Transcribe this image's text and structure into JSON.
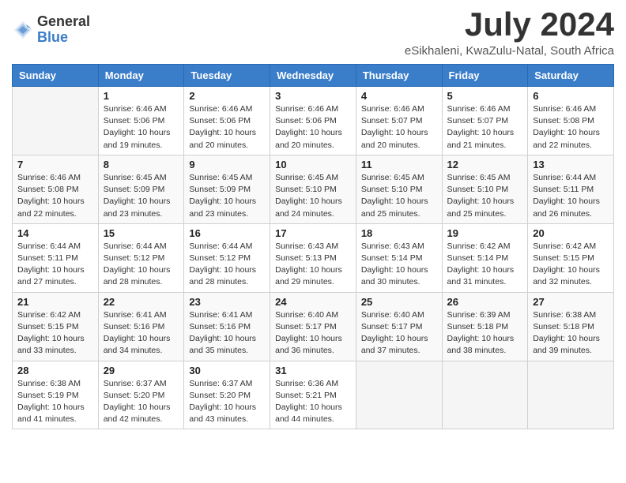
{
  "logo": {
    "general": "General",
    "blue": "Blue"
  },
  "title": "July 2024",
  "subtitle": "eSikhaleni, KwaZulu-Natal, South Africa",
  "weekdays": [
    "Sunday",
    "Monday",
    "Tuesday",
    "Wednesday",
    "Thursday",
    "Friday",
    "Saturday"
  ],
  "weeks": [
    [
      {
        "day": "",
        "info": ""
      },
      {
        "day": "1",
        "info": "Sunrise: 6:46 AM\nSunset: 5:06 PM\nDaylight: 10 hours\nand 19 minutes."
      },
      {
        "day": "2",
        "info": "Sunrise: 6:46 AM\nSunset: 5:06 PM\nDaylight: 10 hours\nand 20 minutes."
      },
      {
        "day": "3",
        "info": "Sunrise: 6:46 AM\nSunset: 5:06 PM\nDaylight: 10 hours\nand 20 minutes."
      },
      {
        "day": "4",
        "info": "Sunrise: 6:46 AM\nSunset: 5:07 PM\nDaylight: 10 hours\nand 20 minutes."
      },
      {
        "day": "5",
        "info": "Sunrise: 6:46 AM\nSunset: 5:07 PM\nDaylight: 10 hours\nand 21 minutes."
      },
      {
        "day": "6",
        "info": "Sunrise: 6:46 AM\nSunset: 5:08 PM\nDaylight: 10 hours\nand 22 minutes."
      }
    ],
    [
      {
        "day": "7",
        "info": "Sunrise: 6:46 AM\nSunset: 5:08 PM\nDaylight: 10 hours\nand 22 minutes."
      },
      {
        "day": "8",
        "info": "Sunrise: 6:45 AM\nSunset: 5:09 PM\nDaylight: 10 hours\nand 23 minutes."
      },
      {
        "day": "9",
        "info": "Sunrise: 6:45 AM\nSunset: 5:09 PM\nDaylight: 10 hours\nand 23 minutes."
      },
      {
        "day": "10",
        "info": "Sunrise: 6:45 AM\nSunset: 5:10 PM\nDaylight: 10 hours\nand 24 minutes."
      },
      {
        "day": "11",
        "info": "Sunrise: 6:45 AM\nSunset: 5:10 PM\nDaylight: 10 hours\nand 25 minutes."
      },
      {
        "day": "12",
        "info": "Sunrise: 6:45 AM\nSunset: 5:10 PM\nDaylight: 10 hours\nand 25 minutes."
      },
      {
        "day": "13",
        "info": "Sunrise: 6:44 AM\nSunset: 5:11 PM\nDaylight: 10 hours\nand 26 minutes."
      }
    ],
    [
      {
        "day": "14",
        "info": "Sunrise: 6:44 AM\nSunset: 5:11 PM\nDaylight: 10 hours\nand 27 minutes."
      },
      {
        "day": "15",
        "info": "Sunrise: 6:44 AM\nSunset: 5:12 PM\nDaylight: 10 hours\nand 28 minutes."
      },
      {
        "day": "16",
        "info": "Sunrise: 6:44 AM\nSunset: 5:12 PM\nDaylight: 10 hours\nand 28 minutes."
      },
      {
        "day": "17",
        "info": "Sunrise: 6:43 AM\nSunset: 5:13 PM\nDaylight: 10 hours\nand 29 minutes."
      },
      {
        "day": "18",
        "info": "Sunrise: 6:43 AM\nSunset: 5:14 PM\nDaylight: 10 hours\nand 30 minutes."
      },
      {
        "day": "19",
        "info": "Sunrise: 6:42 AM\nSunset: 5:14 PM\nDaylight: 10 hours\nand 31 minutes."
      },
      {
        "day": "20",
        "info": "Sunrise: 6:42 AM\nSunset: 5:15 PM\nDaylight: 10 hours\nand 32 minutes."
      }
    ],
    [
      {
        "day": "21",
        "info": "Sunrise: 6:42 AM\nSunset: 5:15 PM\nDaylight: 10 hours\nand 33 minutes."
      },
      {
        "day": "22",
        "info": "Sunrise: 6:41 AM\nSunset: 5:16 PM\nDaylight: 10 hours\nand 34 minutes."
      },
      {
        "day": "23",
        "info": "Sunrise: 6:41 AM\nSunset: 5:16 PM\nDaylight: 10 hours\nand 35 minutes."
      },
      {
        "day": "24",
        "info": "Sunrise: 6:40 AM\nSunset: 5:17 PM\nDaylight: 10 hours\nand 36 minutes."
      },
      {
        "day": "25",
        "info": "Sunrise: 6:40 AM\nSunset: 5:17 PM\nDaylight: 10 hours\nand 37 minutes."
      },
      {
        "day": "26",
        "info": "Sunrise: 6:39 AM\nSunset: 5:18 PM\nDaylight: 10 hours\nand 38 minutes."
      },
      {
        "day": "27",
        "info": "Sunrise: 6:38 AM\nSunset: 5:18 PM\nDaylight: 10 hours\nand 39 minutes."
      }
    ],
    [
      {
        "day": "28",
        "info": "Sunrise: 6:38 AM\nSunset: 5:19 PM\nDaylight: 10 hours\nand 41 minutes."
      },
      {
        "day": "29",
        "info": "Sunrise: 6:37 AM\nSunset: 5:20 PM\nDaylight: 10 hours\nand 42 minutes."
      },
      {
        "day": "30",
        "info": "Sunrise: 6:37 AM\nSunset: 5:20 PM\nDaylight: 10 hours\nand 43 minutes."
      },
      {
        "day": "31",
        "info": "Sunrise: 6:36 AM\nSunset: 5:21 PM\nDaylight: 10 hours\nand 44 minutes."
      },
      {
        "day": "",
        "info": ""
      },
      {
        "day": "",
        "info": ""
      },
      {
        "day": "",
        "info": ""
      }
    ]
  ]
}
